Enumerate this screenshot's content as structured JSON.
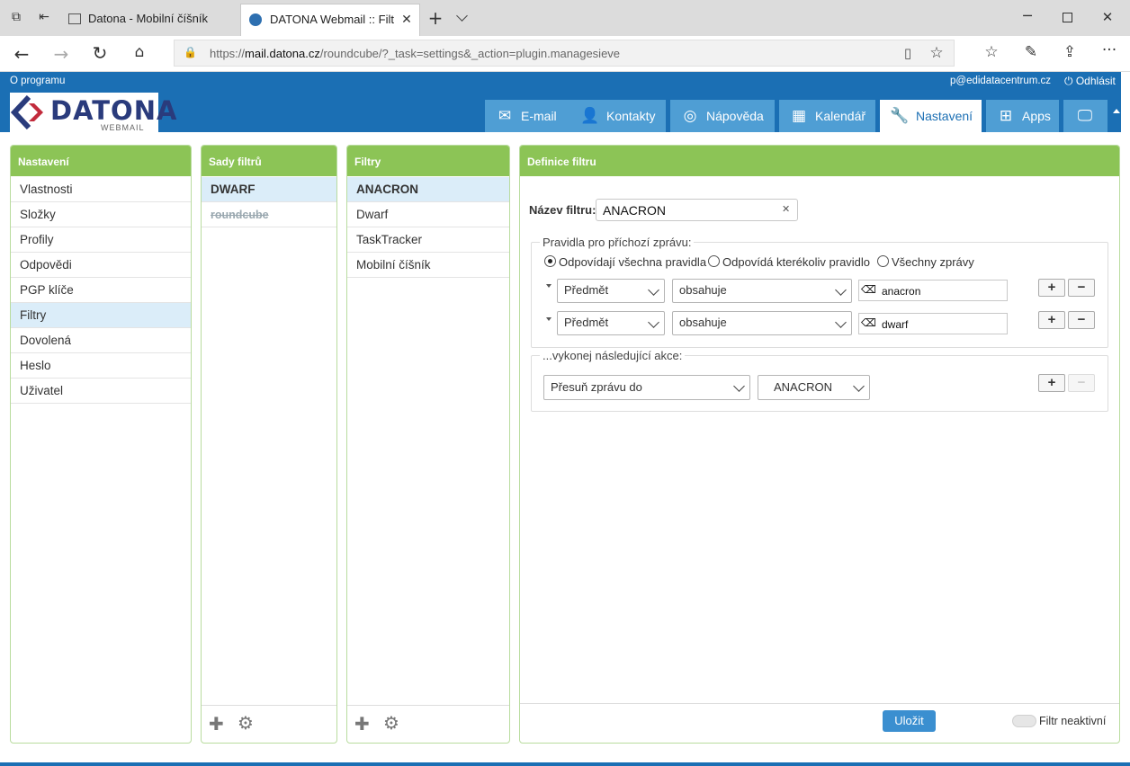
{
  "browser": {
    "tabs": [
      {
        "title": "Datona - Mobilní číšník"
      },
      {
        "title": "DATONA Webmail :: Filt"
      }
    ],
    "url_prefix": "https://",
    "url_domain": "mail.datona.cz",
    "url_path": "/roundcube/?_task=settings&_action=plugin.managesieve"
  },
  "header": {
    "about": "O programu",
    "user": "p@edidatacentrum.cz",
    "logout": "Odhlásit",
    "logo_text": "DATONA",
    "logo_sub": "WEBMAIL",
    "nav": [
      {
        "label": "E-mail",
        "icon": "envelope-icon"
      },
      {
        "label": "Kontakty",
        "icon": "user-icon"
      },
      {
        "label": "Nápověda",
        "icon": "lifebuoy-icon"
      },
      {
        "label": "Kalendář",
        "icon": "calendar-icon"
      },
      {
        "label": "Nastavení",
        "icon": "wrench-icon"
      },
      {
        "label": "Apps",
        "icon": "plus-square-icon"
      }
    ]
  },
  "settings_panel": {
    "title": "Nastavení",
    "items": [
      "Vlastnosti",
      "Složky",
      "Profily",
      "Odpovědi",
      "PGP klíče",
      "Filtry",
      "Dovolená",
      "Heslo",
      "Uživatel"
    ],
    "selected": "Filtry"
  },
  "filter_sets": {
    "title": "Sady filtrů",
    "items": [
      "DWARF",
      "roundcube"
    ]
  },
  "filters": {
    "title": "Filtry",
    "items": [
      "ANACRON",
      "Dwarf",
      "TaskTracker",
      "Mobilní číšník"
    ]
  },
  "definition": {
    "title": "Definice filtru",
    "name_label": "Název filtru:",
    "name_value": "ANACRON",
    "rules_legend": "Pravidla pro příchozí zprávu:",
    "match_options": [
      "Odpovídají všechna pravidla",
      "Odpovídá kterékoliv pravidlo",
      "Všechny zprávy"
    ],
    "match_selected": "Odpovídají všechna pravidla",
    "rules": [
      {
        "header": "Předmět",
        "operator": "obsahuje",
        "value": "anacron"
      },
      {
        "header": "Předmět",
        "operator": "obsahuje",
        "value": "dwarf"
      }
    ],
    "actions_legend": "...vykonej následující akce:",
    "action": {
      "type": "Přesuň zprávu do",
      "folder": "ANACRON"
    },
    "save_label": "Uložit",
    "inactive_label": "Filtr neaktivní",
    "plus": "+",
    "minus": "−"
  }
}
